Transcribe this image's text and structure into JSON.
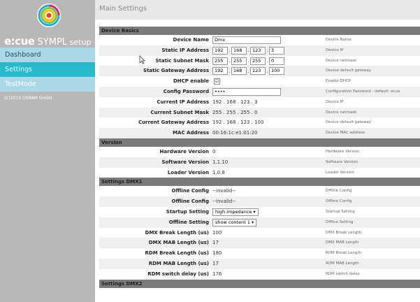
{
  "brand": {
    "part1": "e:cue",
    "part2": " SYMPL",
    "part3": " setup"
  },
  "nav": [
    {
      "label": "Dashboard"
    },
    {
      "label": "Settings"
    },
    {
      "label": "TestMode"
    }
  ],
  "copyright": "(C)2019 OSRAM GmbH",
  "page_title": "Main Settings",
  "device_basics": {
    "title": "Device Basics",
    "device_name": {
      "label": "Device Name",
      "value": "Dmx",
      "desc": "Device Name"
    },
    "static_ip": {
      "label": "Static IP Address",
      "octets": [
        "192",
        "168",
        "123",
        "3"
      ],
      "desc": "Device IP"
    },
    "static_mask": {
      "label": "Static Subnet Mask",
      "octets": [
        "255",
        "255",
        "255",
        "0"
      ],
      "desc": "Device netmask"
    },
    "static_gw": {
      "label": "Static Gateway Address",
      "octets": [
        "192",
        "168",
        "123",
        "100"
      ],
      "desc": "Device default gateway"
    },
    "dhcp": {
      "label": "DHCP enable",
      "checked": "☑",
      "desc": "Enable DHCP"
    },
    "config_pw": {
      "label": "Config Password",
      "value": "••••",
      "desc": "Configuration Password - default: ecue"
    },
    "cur_ip": {
      "label": "Current IP Address",
      "value": "192 . 168 . 123 . 3",
      "desc": "Device IP"
    },
    "cur_mask": {
      "label": "Current Subnet Mask",
      "value": "255 . 255 . 255 . 0",
      "desc": "Device netmask"
    },
    "cur_gw": {
      "label": "Current Gateway Address",
      "value": "192 . 168 . 123 . 100",
      "desc": "Device default gateway"
    },
    "mac": {
      "label": "MAC Address",
      "value": "00:16:1c:e1:01:20",
      "desc": "Device MAC address"
    }
  },
  "version": {
    "title": "Version",
    "hw": {
      "label": "Hardware Version",
      "value": "0",
      "desc": "Hardware Version"
    },
    "sw": {
      "label": "Software Version",
      "value": "1.1.10",
      "desc": "Software Version"
    },
    "loader": {
      "label": "Loader Version",
      "value": "1.0.8",
      "desc": "Loader Version"
    }
  },
  "dmx1": {
    "title": "Settings DMX1",
    "offline1": {
      "label": "Offline Config",
      "value": "--invalid--",
      "desc": "Offline Config"
    },
    "offline2": {
      "label": "Offline Config",
      "value": "--invalid--",
      "desc": "Offline Config"
    },
    "startup": {
      "label": "Startup Setting",
      "value": "high impedance",
      "desc": "Startup Setting"
    },
    "offline_setting": {
      "label": "Offline Setting",
      "value": "show content 1",
      "desc": "Offline Setting"
    },
    "break": {
      "label": "DMX Break Length (us)",
      "value": "100",
      "desc": "DMX Break Length"
    },
    "mab": {
      "label": "DMX MAB Length (us)",
      "value": "17",
      "desc": "DMX MAB Length"
    },
    "rdm_break": {
      "label": "RDM Break Length (us)",
      "value": "180",
      "desc": "RDM Break Length"
    },
    "rdm_mab": {
      "label": "RDM MAB Length (us)",
      "value": "17",
      "desc": "RDM MAB Length"
    },
    "rdm_delay": {
      "label": "RDM switch delay (us)",
      "value": "176",
      "desc": "RDM switch delay"
    }
  },
  "dmx2": {
    "title": "Settings DMX2"
  },
  "icons": {
    "dropdown": "▾"
  }
}
